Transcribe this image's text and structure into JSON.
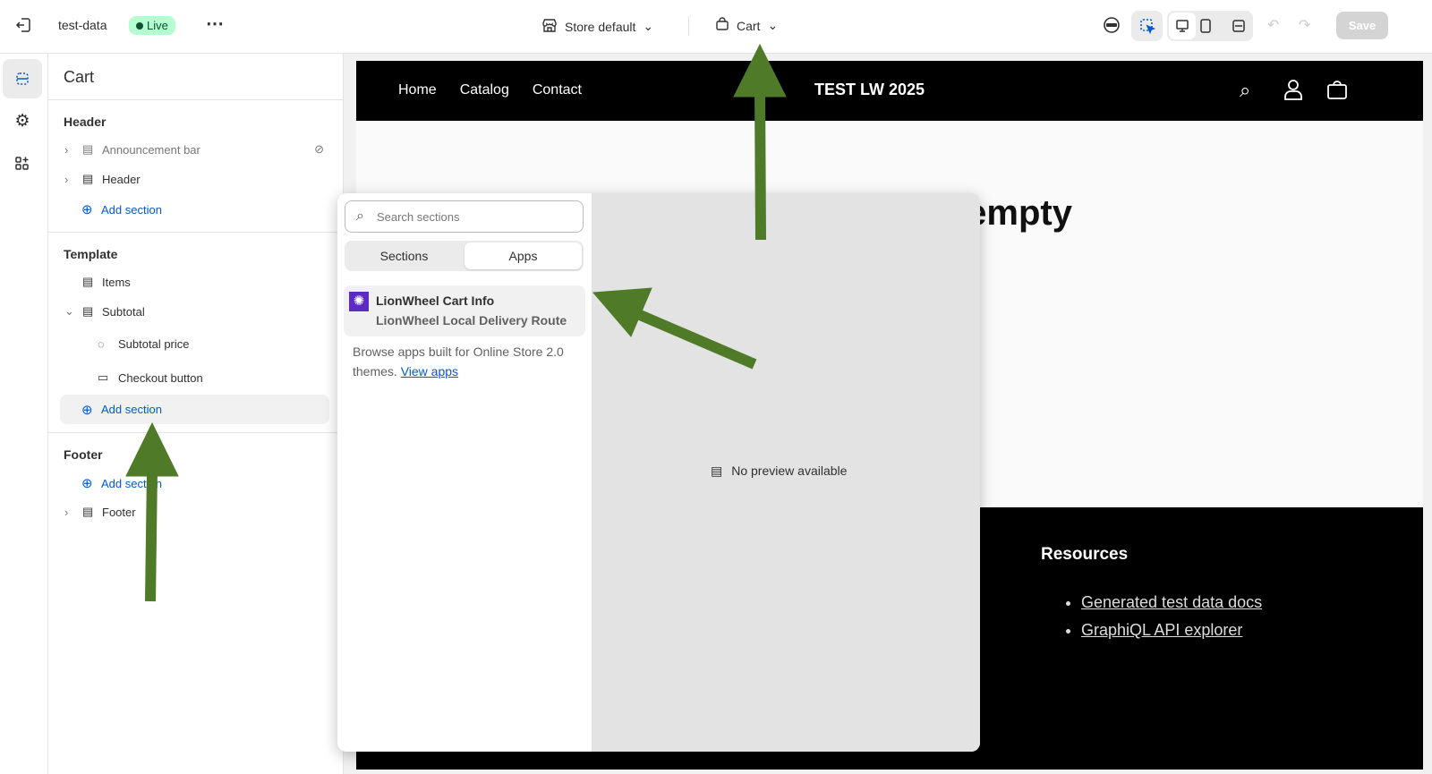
{
  "topbar": {
    "store_name": "test-data",
    "status": "Live",
    "store_select": "Store default",
    "page_select": "Cart",
    "save": "Save"
  },
  "sidebar": {
    "title": "Cart",
    "header_group": "Header",
    "header_items": [
      "Announcement bar",
      "Header"
    ],
    "add_section": "Add section",
    "template_group": "Template",
    "template_items": [
      "Items",
      "Subtotal",
      "Subtotal price",
      "Checkout button"
    ],
    "footer_group": "Footer",
    "footer_items": [
      "Footer"
    ]
  },
  "preview": {
    "nav": [
      "Home",
      "Catalog",
      "Contact"
    ],
    "brand": "TEST LW 2025",
    "heading": "Your cart is empty",
    "resources_title": "Resources",
    "resources": [
      "Generated test data docs",
      "GraphiQL API explorer"
    ]
  },
  "popup": {
    "search_placeholder": "Search sections",
    "tabs": [
      "Sections",
      "Apps"
    ],
    "active_tab": "Apps",
    "app_title": "LionWheel Cart Info",
    "app_subtitle": "LionWheel Local Delivery Route",
    "browse_text": "Browse apps built for Online Store 2.0 themes.",
    "view_apps": "View apps",
    "no_preview": "No preview available"
  },
  "colors": {
    "accent": "#005bd3",
    "arrow": "#4f7a28",
    "live_bg": "#b4fed2",
    "app_icon": "#5b2bc4"
  }
}
